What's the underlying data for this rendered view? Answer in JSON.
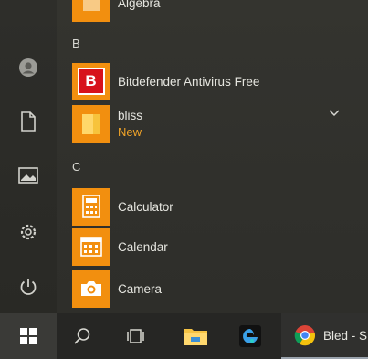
{
  "start_menu": {
    "scrolled_item": {
      "label": "Algebra"
    },
    "groups": [
      {
        "letter": "B",
        "apps": [
          {
            "label": "Bitdefender Antivirus Free",
            "icon": "bitdefender-icon"
          },
          {
            "label": "bliss",
            "sublabel": "New",
            "icon": "folder-icon",
            "expandable": true
          }
        ]
      },
      {
        "letter": "C",
        "apps": [
          {
            "label": "Calculator",
            "icon": "calculator-icon"
          },
          {
            "label": "Calendar",
            "icon": "calendar-icon"
          },
          {
            "label": "Camera",
            "icon": "camera-icon"
          }
        ]
      }
    ]
  },
  "rail": [
    "user-icon",
    "document-icon",
    "pictures-icon",
    "settings-icon",
    "power-icon"
  ],
  "taskbar": {
    "chrome_label": "Bled - S",
    "icons": [
      "windows-start-icon",
      "search-icon",
      "task-view-icon",
      "file-explorer-icon",
      "edge-icon",
      "chrome-icon"
    ]
  },
  "colors": {
    "tile": "#f28f0f",
    "bitdefender": "#d7121b",
    "new_label": "#f0a328"
  }
}
